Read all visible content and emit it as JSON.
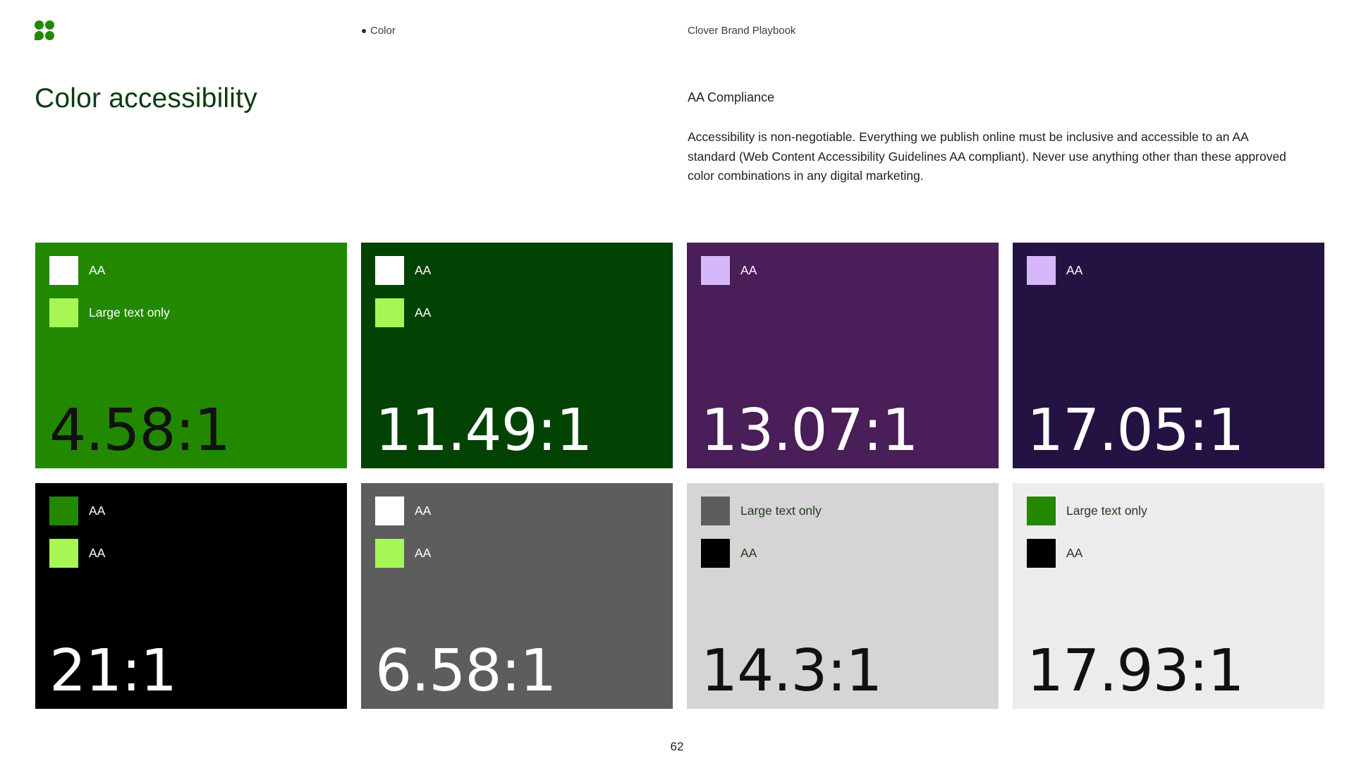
{
  "header": {
    "section": "Color",
    "document_title": "Clover Brand Playbook"
  },
  "page_title": "Color accessibility",
  "compliance": {
    "heading": "AA Compliance",
    "body": "Accessibility is non-negotiable. Everything we publish online must be inclusive and accessible to an AA standard (Web Content Accessibility Guidelines AA compliant). Never use anything other than these approved color combinations in any digital marketing."
  },
  "cards": [
    {
      "background": "#228800",
      "ratio": "4.58:1",
      "ratio_color": "#111111",
      "label_color": "#ffffff",
      "rows": [
        {
          "swatch": "#ffffff",
          "label": "AA"
        },
        {
          "swatch": "#a6f753",
          "label": "Large text only"
        }
      ]
    },
    {
      "background": "#024202",
      "ratio": "11.49:1",
      "ratio_color": "#ffffff",
      "label_color": "#ffffff",
      "rows": [
        {
          "swatch": "#ffffff",
          "label": "AA"
        },
        {
          "swatch": "#a6f753",
          "label": "AA"
        }
      ]
    },
    {
      "background": "#4a1e59",
      "ratio": "13.07:1",
      "ratio_color": "#ffffff",
      "label_color": "#ffffff",
      "rows": [
        {
          "swatch": "#d6b8fa",
          "label": "AA"
        }
      ]
    },
    {
      "background": "#241342",
      "ratio": "17.05:1",
      "ratio_color": "#ffffff",
      "label_color": "#ffffff",
      "rows": [
        {
          "swatch": "#d6b8fa",
          "label": "AA"
        }
      ]
    },
    {
      "background": "#000000",
      "ratio": "21:1",
      "ratio_color": "#ffffff",
      "label_color": "#ffffff",
      "rows": [
        {
          "swatch": "#228800",
          "label": "AA"
        },
        {
          "swatch": "#a6f753",
          "label": "AA"
        }
      ]
    },
    {
      "background": "#5d5d5d",
      "ratio": "6.58:1",
      "ratio_color": "#ffffff",
      "label_color": "#ffffff",
      "rows": [
        {
          "swatch": "#ffffff",
          "label": "AA"
        },
        {
          "swatch": "#a6f753",
          "label": "AA"
        }
      ]
    },
    {
      "background": "#d5d5d5",
      "ratio": "14.3:1",
      "ratio_color": "#111111",
      "label_color": "#1f3a1a",
      "rows": [
        {
          "swatch": "#5d5d5d",
          "label": "Large text only"
        },
        {
          "swatch": "#000000",
          "label": "AA"
        }
      ]
    },
    {
      "background": "#ececec",
      "ratio": "17.93:1",
      "ratio_color": "#111111",
      "label_color": "#1f3a1a",
      "rows": [
        {
          "swatch": "#228800",
          "label": "Large text only"
        },
        {
          "swatch": "#000000",
          "label": "AA"
        }
      ]
    }
  ],
  "page_number": "62",
  "colors": {
    "logo": "#228800",
    "title": "#0d3b10"
  },
  "icons": {
    "logo": "clover-logo-icon"
  }
}
